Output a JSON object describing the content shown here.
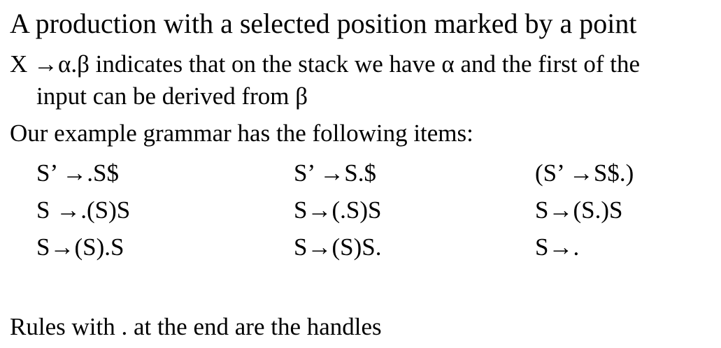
{
  "title": "A production with a selected position marked by a point",
  "definition": {
    "line1": "X →α.β indicates that on the stack we have α and the first of the",
    "line2": "input can be derived from β"
  },
  "intro": "Our example grammar has the following items:",
  "items": [
    [
      "S’ →.S$",
      "S’ →S.$",
      "(S’ →S$.)"
    ],
    [
      "S →.(S)S",
      "S→(.S)S",
      "S→(S.)S"
    ],
    [
      "S→(S).S",
      "S→(S)S.",
      "S→."
    ]
  ],
  "footer": "Rules with . at the end are the handles"
}
